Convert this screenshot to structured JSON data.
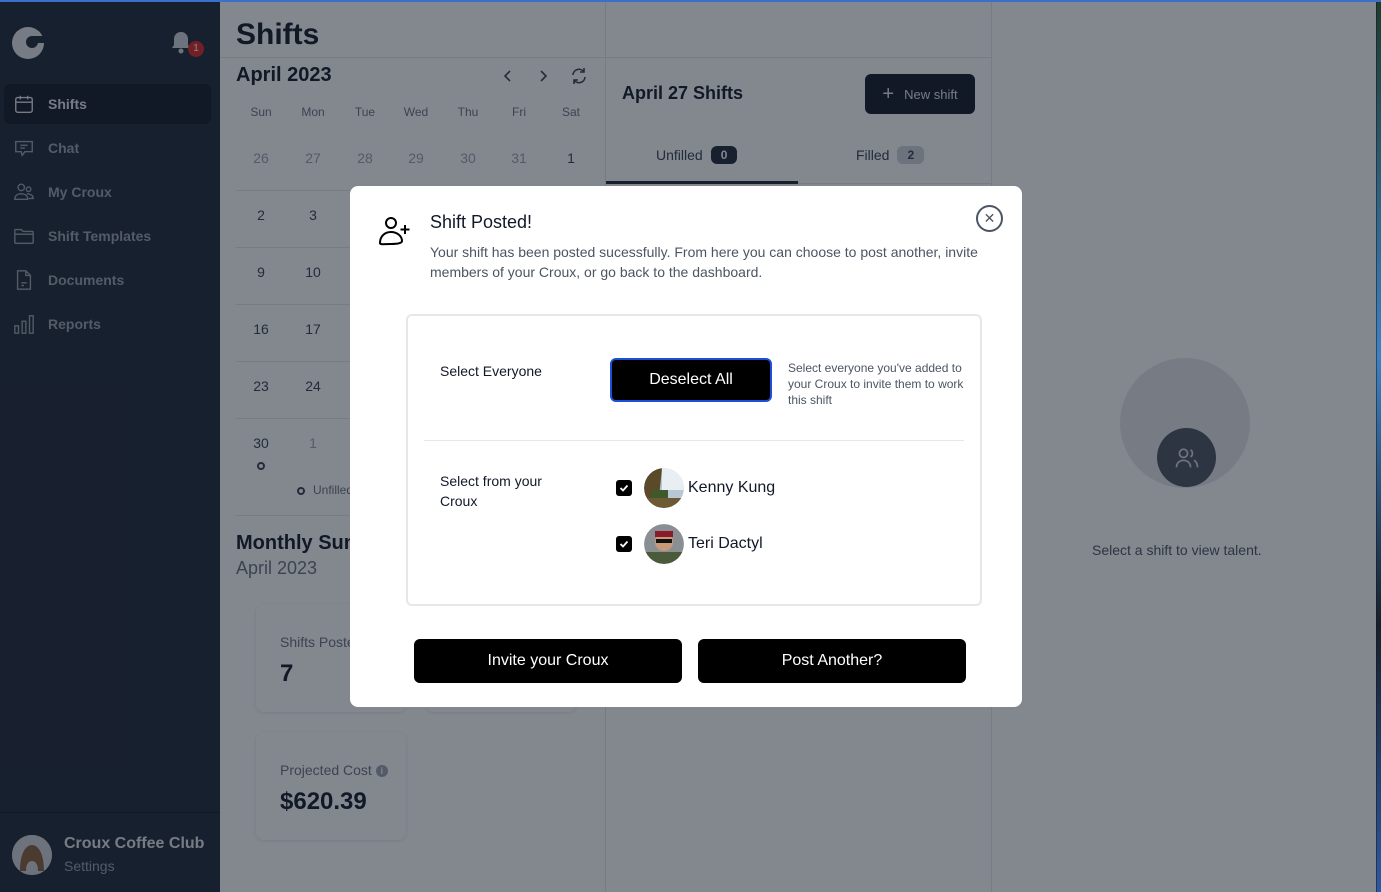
{
  "sidebar": {
    "notification_count": "1",
    "items": [
      {
        "label": "Shifts",
        "icon": "calendar-icon",
        "active": true
      },
      {
        "label": "Chat",
        "icon": "chat-icon",
        "active": false
      },
      {
        "label": "My Croux",
        "icon": "users-icon",
        "active": false
      },
      {
        "label": "Shift Templates",
        "icon": "folder-icon",
        "active": false
      },
      {
        "label": "Documents",
        "icon": "document-icon",
        "active": false
      },
      {
        "label": "Reports",
        "icon": "bar-chart-icon",
        "active": false
      }
    ],
    "profile": {
      "name": "Croux Coffee Club",
      "settings_label": "Settings"
    }
  },
  "page": {
    "title": "Shifts"
  },
  "calendar": {
    "month_label": "April 2023",
    "weekdays": [
      "Sun",
      "Mon",
      "Tue",
      "Wed",
      "Thu",
      "Fri",
      "Sat"
    ],
    "rows": [
      [
        "26",
        "27",
        "28",
        "29",
        "30",
        "31",
        "1"
      ],
      [
        "2",
        "3"
      ],
      [
        "9",
        "10"
      ],
      [
        "16",
        "17"
      ],
      [
        "23",
        "24"
      ],
      [
        "30",
        "1"
      ]
    ],
    "legend_unfilled": "Unfilled"
  },
  "summary": {
    "title": "Monthly Summary",
    "period": "April 2023",
    "shifts_posted_label": "Shifts Posted",
    "shifts_posted_value": "7",
    "projected_cost_label": "Projected Cost",
    "projected_cost_value": "$620.39"
  },
  "day_panel": {
    "title": "April 27 Shifts",
    "new_shift_label": "New shift",
    "tabs": [
      {
        "label": "Unfilled",
        "count": "0",
        "active": true
      },
      {
        "label": "Filled",
        "count": "2",
        "active": false
      }
    ]
  },
  "talent_panel": {
    "empty_text": "Select a shift to view talent."
  },
  "modal": {
    "title": "Shift Posted!",
    "description": "Your shift has been posted sucessfully. From here you can choose to post another, invite members of your Croux, or go back to the dashboard.",
    "select_everyone_label": "Select Everyone",
    "deselect_all_label": "Deselect All",
    "select_help": "Select everyone you've added to your Croux to invite them to work this shift",
    "select_from_label": "Select from your Croux",
    "members": [
      {
        "name": "Kenny Kung",
        "checked": true
      },
      {
        "name": "Teri Dactyl",
        "checked": true
      }
    ],
    "invite_label": "Invite your Croux",
    "post_another_label": "Post Another?"
  },
  "colors": {
    "sidebar_bg": "#1f2937",
    "primary_button": "#000000",
    "focus_ring": "#1d4ed8",
    "badge_red": "#dc2626"
  }
}
